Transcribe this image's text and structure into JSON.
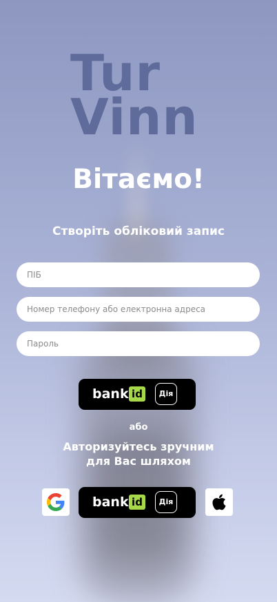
{
  "brand": {
    "line1": "Tur",
    "line2": "Vinn"
  },
  "welcome": "Вітаємо!",
  "subtitle": "Створіть обліковий запис",
  "form": {
    "full_name_placeholder": "ПІБ",
    "contact_placeholder": "Номер телефону або електронна адреса",
    "password_placeholder": "Пароль"
  },
  "bankid": {
    "bank_text": "bank",
    "id_text": "id",
    "diia_text": "Дія"
  },
  "or_text": "або",
  "auth": {
    "line1": "Авторизуйтесь зручним",
    "line2": "для Вас шляхом"
  },
  "social": {
    "google_icon": "google-icon",
    "apple_icon": "apple-icon"
  },
  "colors": {
    "background_top": "#8d97c0",
    "background_bottom": "#d4daf0",
    "logo": "#5b6797",
    "id_green": "#a6d84a",
    "button_black": "#000000"
  }
}
